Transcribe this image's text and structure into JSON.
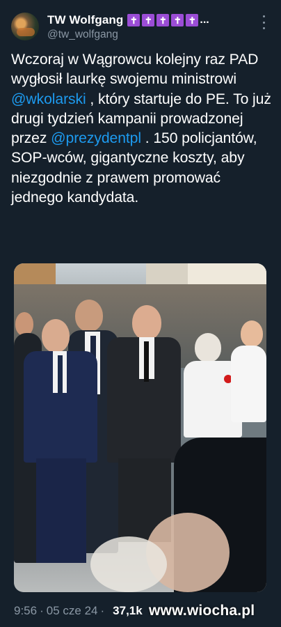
{
  "author": {
    "display_name": "TW Wolfgang",
    "badges": [
      "✝",
      "✝",
      "✝",
      "✝",
      "✝"
    ],
    "ellipsis": "...",
    "handle": "@tw_wolfgang"
  },
  "menu": {
    "icon": "more-vertical-icon"
  },
  "tweet": {
    "segments": [
      {
        "text": "Wczoraj w Wągrowcu kolejny raz PAD wygłosił laurkę swojemu ministrowi ",
        "type": "text"
      },
      {
        "text": "@wkolarski",
        "type": "mention"
      },
      {
        "text": " , który startuje do PE. To już drugi tydzień kampanii prowadzonej przez ",
        "type": "text"
      },
      {
        "text": "@prezydentpl",
        "type": "mention"
      },
      {
        "text": " . 150 policjantów, SOP-wców, gigantyczne koszty, aby niezgodnie z prawem promować jednego kandydata.",
        "type": "text"
      }
    ]
  },
  "media": {
    "kind": "photo"
  },
  "footer": {
    "time": "9:56",
    "separator": "·",
    "date": "05 cze 24",
    "views": "37,1k"
  },
  "watermark": "www.wiocha.pl",
  "colors": {
    "background": "#15202b",
    "mention": "#1d9bf0",
    "secondary": "#8b98a5",
    "badge": "#9b4dd6"
  }
}
